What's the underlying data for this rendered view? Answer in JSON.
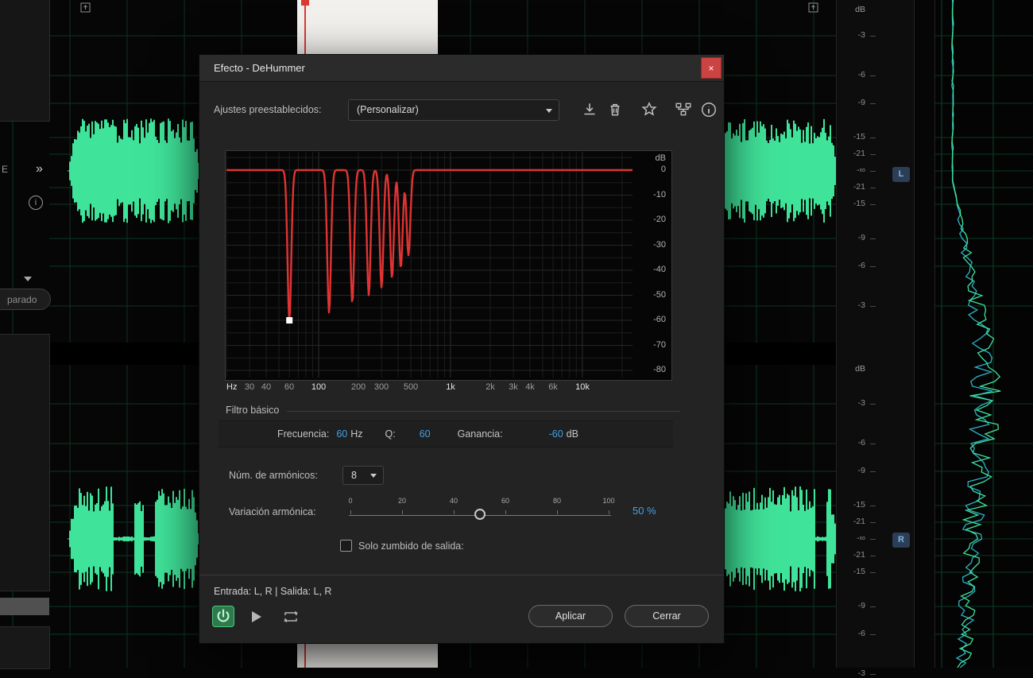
{
  "accent": {
    "value_blue": "#3fa3e8",
    "waveform_green": "#40e39a",
    "curve_red": "#e03434",
    "power_green": "#49c87c"
  },
  "dialog": {
    "title": "Efecto - DeHummer",
    "close_glyph": "×"
  },
  "presets": {
    "label": "Ajustes preestablecidos:",
    "value": "(Personalizar)"
  },
  "graph": {
    "y_unit": "dB",
    "y_ticks": [
      "0",
      "-10",
      "-20",
      "-30",
      "-40",
      "-50",
      "-60",
      "-70",
      "-80"
    ],
    "x_unit_label": "Hz",
    "x_ticks": [
      {
        "label": "30",
        "f": 30,
        "strong": false
      },
      {
        "label": "40",
        "f": 40,
        "strong": false
      },
      {
        "label": "60",
        "f": 60,
        "strong": false
      },
      {
        "label": "100",
        "f": 100,
        "strong": true
      },
      {
        "label": "200",
        "f": 200,
        "strong": false
      },
      {
        "label": "300",
        "f": 300,
        "strong": false
      },
      {
        "label": "500",
        "f": 500,
        "strong": false
      },
      {
        "label": "1k",
        "f": 1000,
        "strong": true
      },
      {
        "label": "2k",
        "f": 2000,
        "strong": false
      },
      {
        "label": "3k",
        "f": 3000,
        "strong": false
      },
      {
        "label": "4k",
        "f": 4000,
        "strong": false
      },
      {
        "label": "6k",
        "f": 6000,
        "strong": false
      },
      {
        "label": "10k",
        "f": 10000,
        "strong": true
      }
    ],
    "f_min": 20,
    "f_max": 24000
  },
  "chart_data": {
    "type": "line",
    "title": "DeHummer frequency response",
    "xlabel": "Hz (log scale)",
    "ylabel": "dB",
    "ylim": [
      -80,
      0
    ],
    "baseline_db": 0,
    "fundamental_hz": 60,
    "harmonics": 8,
    "notch_freqs_hz": [
      60,
      120,
      180,
      240,
      300,
      360,
      420,
      480
    ],
    "notch_depths_db": [
      -60,
      -57,
      -53,
      -50,
      -47,
      -43,
      -39,
      -34
    ],
    "handle": {
      "hz": 60,
      "db": -60
    }
  },
  "filter_group": {
    "label": "Filtro básico",
    "frequency_label": "Frecuencia:",
    "frequency_value": "60",
    "frequency_unit": "Hz",
    "q_label": "Q:",
    "q_value": "60",
    "gain_label": "Ganancia:",
    "gain_value": "-60",
    "gain_unit": "dB"
  },
  "harmonics_row": {
    "label": "Núm. de armónicos:",
    "value": "8"
  },
  "variation_row": {
    "label": "Variación armónica:",
    "scale": [
      "0",
      "20",
      "40",
      "60",
      "80",
      "100"
    ],
    "value_label": "50 %",
    "percent": 50
  },
  "output_row": {
    "label": "Solo zumbido de salida:",
    "checked": false
  },
  "footer": {
    "io_text": "Entrada: L, R | Salida: L, R",
    "apply_label": "Aplicar",
    "close_label": "Cerrar"
  },
  "background": {
    "left_panel": {
      "tab_label": "E",
      "expand_glyph": "»",
      "info_glyph": "i",
      "status_label": "parado"
    },
    "meter": {
      "unit": "dB",
      "labels": [
        "-3",
        "-6",
        "-9",
        "-15",
        "-21",
        "-∞",
        "-21",
        "-15",
        "-9",
        "-6",
        "-3"
      ],
      "left_badge": "L",
      "right_badge": "R"
    }
  }
}
